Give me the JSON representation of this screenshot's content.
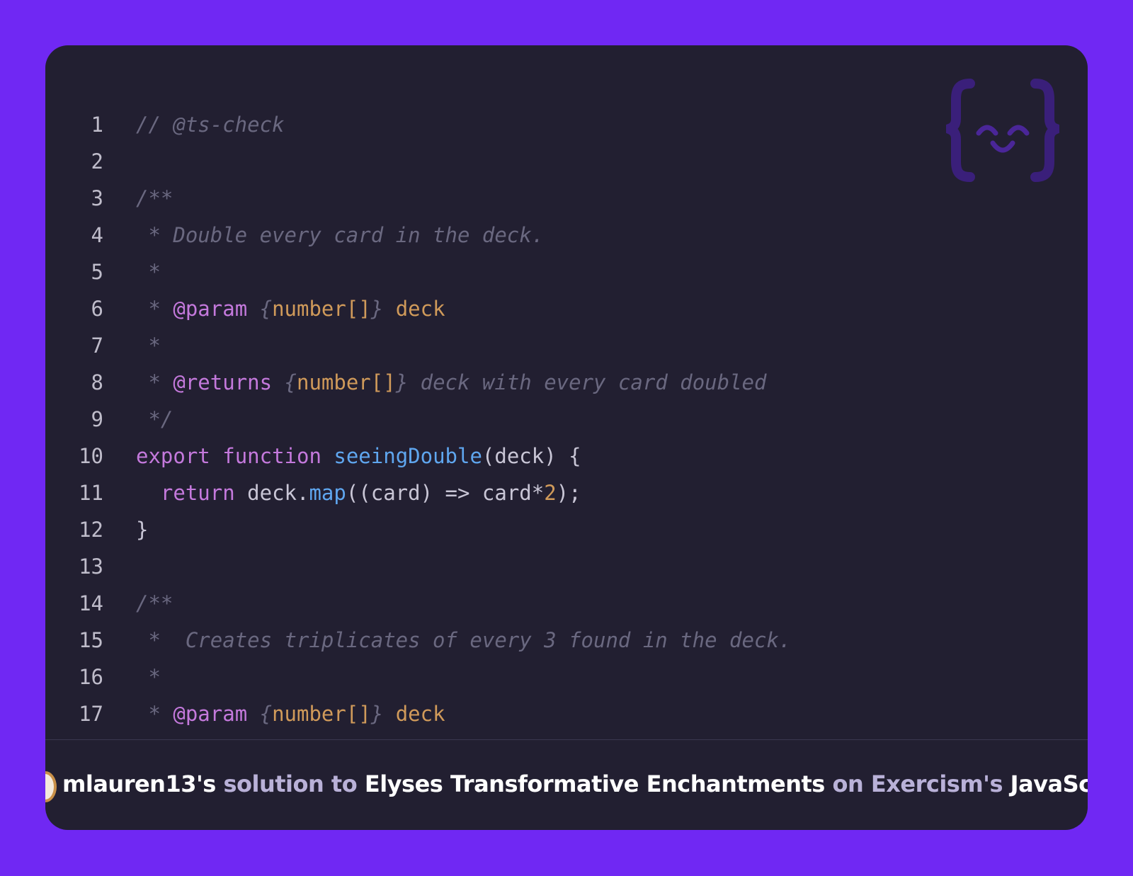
{
  "code_lines": [
    {
      "n": "1",
      "parts": [
        {
          "text": "// @ts-check",
          "cls": "c"
        }
      ]
    },
    {
      "n": "2",
      "parts": []
    },
    {
      "n": "3",
      "parts": [
        {
          "text": "/**",
          "cls": "c"
        }
      ]
    },
    {
      "n": "4",
      "parts": [
        {
          "text": " * Double every card in the deck.",
          "cls": "c"
        }
      ]
    },
    {
      "n": "5",
      "parts": [
        {
          "text": " *",
          "cls": "c"
        }
      ]
    },
    {
      "n": "6",
      "parts": [
        {
          "text": " * ",
          "cls": "c"
        },
        {
          "text": "@param",
          "cls": "k"
        },
        {
          "text": " {",
          "cls": "c"
        },
        {
          "text": "number[]",
          "cls": "t"
        },
        {
          "text": "} ",
          "cls": "c"
        },
        {
          "text": "deck",
          "cls": "t"
        }
      ]
    },
    {
      "n": "7",
      "parts": [
        {
          "text": " *",
          "cls": "c"
        }
      ]
    },
    {
      "n": "8",
      "parts": [
        {
          "text": " * ",
          "cls": "c"
        },
        {
          "text": "@returns",
          "cls": "k"
        },
        {
          "text": " {",
          "cls": "c"
        },
        {
          "text": "number[]",
          "cls": "t"
        },
        {
          "text": "} deck with every card doubled",
          "cls": "c"
        }
      ]
    },
    {
      "n": "9",
      "parts": [
        {
          "text": " */",
          "cls": "c"
        }
      ]
    },
    {
      "n": "10",
      "parts": [
        {
          "text": "export",
          "cls": "k"
        },
        {
          "text": " ",
          "cls": "p"
        },
        {
          "text": "function",
          "cls": "k"
        },
        {
          "text": " ",
          "cls": "p"
        },
        {
          "text": "seeingDouble",
          "cls": "f"
        },
        {
          "text": "(deck) {",
          "cls": "p"
        }
      ]
    },
    {
      "n": "11",
      "parts": [
        {
          "text": "  ",
          "cls": "p"
        },
        {
          "text": "return",
          "cls": "k"
        },
        {
          "text": " deck.",
          "cls": "p"
        },
        {
          "text": "map",
          "cls": "f"
        },
        {
          "text": "((card) => card*",
          "cls": "p"
        },
        {
          "text": "2",
          "cls": "n"
        },
        {
          "text": ");",
          "cls": "p"
        }
      ]
    },
    {
      "n": "12",
      "parts": [
        {
          "text": "}",
          "cls": "p"
        }
      ]
    },
    {
      "n": "13",
      "parts": []
    },
    {
      "n": "14",
      "parts": [
        {
          "text": "/**",
          "cls": "c"
        }
      ]
    },
    {
      "n": "15",
      "parts": [
        {
          "text": " *  Creates triplicates of every 3 found in the deck.",
          "cls": "c"
        }
      ]
    },
    {
      "n": "16",
      "parts": [
        {
          "text": " *",
          "cls": "c"
        }
      ]
    },
    {
      "n": "17",
      "parts": [
        {
          "text": " * ",
          "cls": "c"
        },
        {
          "text": "@param",
          "cls": "k"
        },
        {
          "text": " {",
          "cls": "c"
        },
        {
          "text": "number[]",
          "cls": "t"
        },
        {
          "text": "} ",
          "cls": "c"
        },
        {
          "text": "deck",
          "cls": "t"
        }
      ]
    }
  ],
  "footer": {
    "author": "mlauren13's",
    "solution_to": "solution to",
    "exercise": "Elyses Transformative Enchantments",
    "on_site": "on Exercism's",
    "track": "JavaScript Track"
  },
  "logo_icon": "exercism-logo-icon",
  "colors": {
    "background": "#7028f3",
    "card": "#221f31",
    "comment": "#6a6880",
    "keyword": "#c479dc",
    "function": "#5fa6ef",
    "type": "#d09a5a",
    "plain": "#c9c6d6"
  }
}
